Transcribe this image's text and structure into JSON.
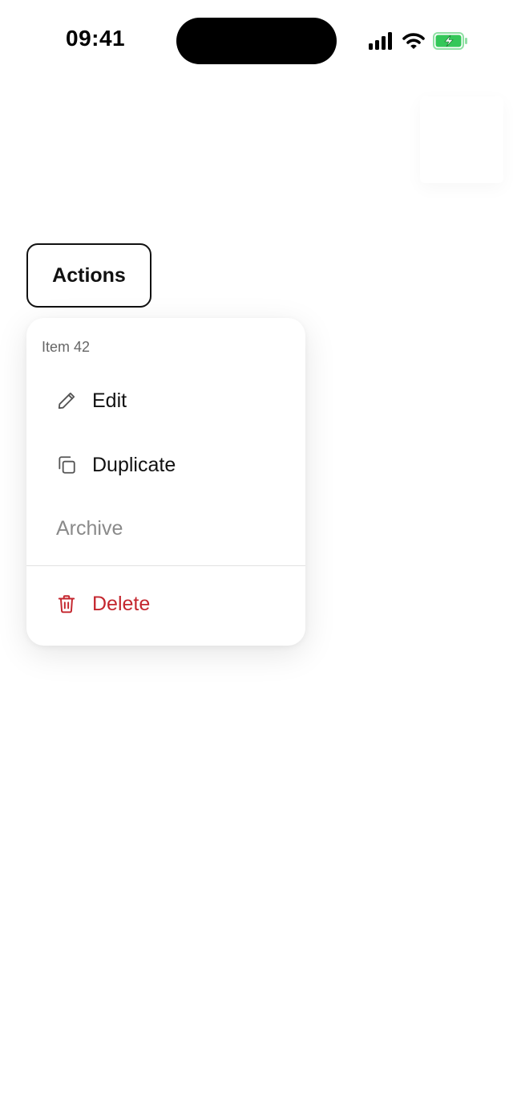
{
  "status_bar": {
    "time": "09:41",
    "icons": [
      "signal-icon",
      "wifi-icon",
      "battery-charging-icon"
    ],
    "battery_color": "#34c759"
  },
  "actions_button": {
    "label": "Actions"
  },
  "menu": {
    "header": "Item 42",
    "items": [
      {
        "label": "Edit",
        "icon": "pencil-icon",
        "state": "enabled"
      },
      {
        "label": "Duplicate",
        "icon": "copy-icon",
        "state": "enabled"
      },
      {
        "label": "Archive",
        "icon": "",
        "state": "disabled"
      },
      {
        "label": "Delete",
        "icon": "trash-icon",
        "state": "destructive"
      }
    ]
  },
  "colors": {
    "destructive": "#c4262e",
    "disabled_text": "#8a8a8a",
    "header_text": "#666666"
  }
}
